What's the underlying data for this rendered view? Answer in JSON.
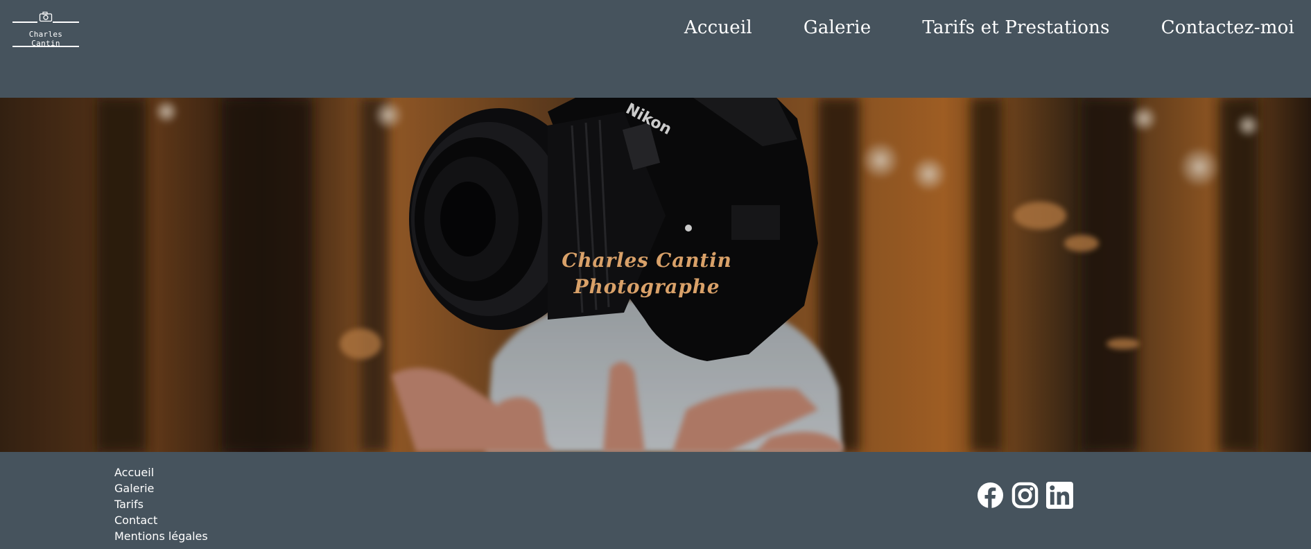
{
  "header": {
    "logo_text": "Charles Cantin",
    "nav": [
      {
        "label": "Accueil"
      },
      {
        "label": "Galerie"
      },
      {
        "label": "Tarifs et Prestations"
      },
      {
        "label": "Contactez-moi"
      }
    ]
  },
  "hero": {
    "title_line1": "Charles Cantin",
    "title_line2": "Photographe",
    "camera_brand": "Nikon"
  },
  "footer": {
    "links": [
      {
        "label": "Accueil"
      },
      {
        "label": "Galerie"
      },
      {
        "label": "Tarifs"
      },
      {
        "label": "Contact"
      },
      {
        "label": "Mentions légales"
      }
    ],
    "socials": [
      {
        "icon": "facebook-icon"
      },
      {
        "icon": "instagram-icon"
      },
      {
        "icon": "linkedin-icon"
      }
    ]
  },
  "colors": {
    "background": "#46535d",
    "hero_title": "#d9a169",
    "text": "#ffffff"
  }
}
